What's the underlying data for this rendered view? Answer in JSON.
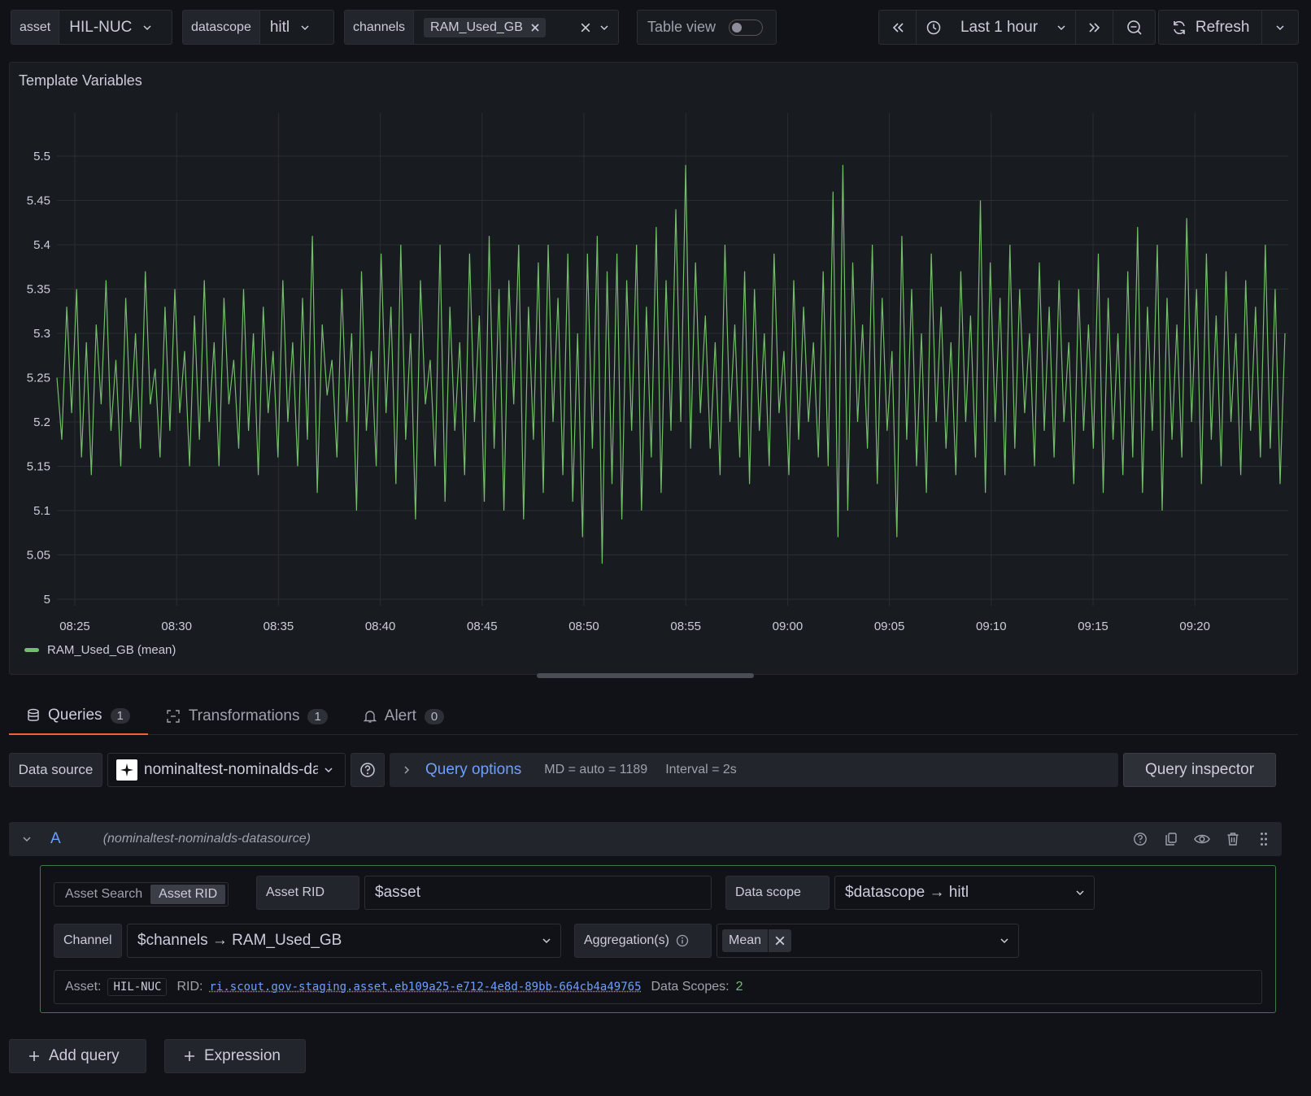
{
  "variables": {
    "asset": {
      "label": "asset",
      "value": "HIL-NUC"
    },
    "datascope": {
      "label": "datascope",
      "value": "hitl"
    },
    "channels": {
      "label": "channels",
      "chip": "RAM_Used_GB"
    },
    "table_view": {
      "label": "Table view",
      "on": false
    }
  },
  "time_controls": {
    "range": "Last 1 hour",
    "refresh": "Refresh"
  },
  "panel": {
    "title": "Template Variables",
    "legend": "RAM_Used_GB (mean)"
  },
  "colors": {
    "series": "#73bf69",
    "accent_blue": "#6e9fff",
    "active_tab": "#f55f3e"
  },
  "chart_data": {
    "type": "line",
    "x_ticks": [
      "08:25",
      "08:30",
      "08:35",
      "08:40",
      "08:45",
      "08:50",
      "08:55",
      "09:00",
      "09:05",
      "09:10",
      "09:15",
      "09:20"
    ],
    "y_ticks": [
      "5",
      "5.05",
      "5.1",
      "5.15",
      "5.2",
      "5.25",
      "5.3",
      "5.35",
      "5.4",
      "5.45",
      "5.5"
    ],
    "ylim": [
      5.0,
      5.5
    ],
    "x_range": [
      "08:24:12",
      "09:24:10"
    ],
    "grid": true,
    "legend_placement": "bottom-left",
    "series": [
      {
        "name": "RAM_Used_GB (mean)",
        "color": "#73bf69",
        "values": [
          5.25,
          5.18,
          5.33,
          5.21,
          5.35,
          5.16,
          5.29,
          5.14,
          5.31,
          5.22,
          5.36,
          5.19,
          5.27,
          5.15,
          5.34,
          5.2,
          5.3,
          5.17,
          5.37,
          5.22,
          5.26,
          5.16,
          5.33,
          5.19,
          5.35,
          5.21,
          5.28,
          5.15,
          5.32,
          5.18,
          5.36,
          5.2,
          5.29,
          5.15,
          5.34,
          5.22,
          5.27,
          5.17,
          5.35,
          5.19,
          5.3,
          5.14,
          5.33,
          5.21,
          5.28,
          5.16,
          5.36,
          5.2,
          5.29,
          5.15,
          5.34,
          5.18,
          5.41,
          5.12,
          5.31,
          5.23,
          5.27,
          5.16,
          5.35,
          5.2,
          5.3,
          5.1,
          5.37,
          5.19,
          5.28,
          5.15,
          5.39,
          5.21,
          5.33,
          5.13,
          5.4,
          5.18,
          5.3,
          5.09,
          5.36,
          5.22,
          5.27,
          5.15,
          5.4,
          5.11,
          5.33,
          5.19,
          5.29,
          5.14,
          5.39,
          5.2,
          5.32,
          5.11,
          5.41,
          5.17,
          5.35,
          5.1,
          5.36,
          5.22,
          5.4,
          5.09,
          5.33,
          5.18,
          5.38,
          5.12,
          5.4,
          5.2,
          5.34,
          5.14,
          5.39,
          5.11,
          5.3,
          5.07,
          5.39,
          5.17,
          5.41,
          5.04,
          5.37,
          5.13,
          5.39,
          5.09,
          5.36,
          5.19,
          5.4,
          5.1,
          5.33,
          5.16,
          5.42,
          5.12,
          5.36,
          5.19,
          5.44,
          5.2,
          5.49,
          5.17,
          5.38,
          5.21,
          5.32,
          5.17,
          5.29,
          5.14,
          5.4,
          5.2,
          5.31,
          5.16,
          5.37,
          5.13,
          5.35,
          5.19,
          5.3,
          5.15,
          5.39,
          5.21,
          5.28,
          5.14,
          5.36,
          5.18,
          5.33,
          5.2,
          5.29,
          5.16,
          5.37,
          5.15,
          5.46,
          5.07,
          5.49,
          5.1,
          5.38,
          5.2,
          5.31,
          5.17,
          5.4,
          5.13,
          5.34,
          5.19,
          5.28,
          5.07,
          5.41,
          5.18,
          5.35,
          5.15,
          5.3,
          5.12,
          5.39,
          5.2,
          5.33,
          5.17,
          5.29,
          5.14,
          5.37,
          5.2,
          5.32,
          5.16,
          5.45,
          5.12,
          5.38,
          5.2,
          5.34,
          5.14,
          5.4,
          5.17,
          5.35,
          5.21,
          5.3,
          5.15,
          5.38,
          5.19,
          5.33,
          5.16,
          5.36,
          5.2,
          5.29,
          5.13,
          5.35,
          5.19,
          5.31,
          5.17,
          5.39,
          5.12,
          5.34,
          5.18,
          5.3,
          5.14,
          5.37,
          5.16,
          5.42,
          5.12,
          5.33,
          5.19,
          5.4,
          5.1,
          5.34,
          5.18,
          5.31,
          5.16,
          5.43,
          5.2,
          5.35,
          5.13,
          5.39,
          5.18,
          5.32,
          5.15,
          5.37,
          5.2,
          5.3,
          5.14,
          5.36,
          5.19,
          5.33,
          5.16,
          5.4,
          5.17,
          5.35,
          5.13,
          5.3
        ]
      }
    ]
  },
  "tabs": [
    {
      "label": "Queries",
      "count": "1",
      "icon": "database-icon"
    },
    {
      "label": "Transformations",
      "count": "1",
      "icon": "transform-icon"
    },
    {
      "label": "Alert",
      "count": "0",
      "icon": "bell-icon"
    }
  ],
  "query_bar": {
    "datasource_label": "Data source",
    "datasource_value": "nominaltest-nominalds-datasource",
    "options_label": "Query options",
    "md": "MD = auto = 1189",
    "interval": "Interval = 2s",
    "inspector": "Query inspector"
  },
  "query": {
    "ref": "A",
    "datasource": "(nominaltest-nominalds-datasource)",
    "mode_options": [
      "Asset Search",
      "Asset RID"
    ],
    "mode_selected": "Asset RID",
    "asset_rid_label": "Asset RID",
    "asset_rid_value": "$asset",
    "datascope_label": "Data scope",
    "datascope_value": "$datascope → hitl",
    "channel_label": "Channel",
    "channel_value": "$channels → RAM_Used_GB",
    "aggregation_label": "Aggregation(s)",
    "aggregation_value": "Mean",
    "info": {
      "asset_label": "Asset:",
      "asset_value": "HIL-NUC",
      "rid_label": "RID:",
      "rid_value": "ri.scout.gov-staging.asset.eb109a25-e712-4e8d-89bb-664cb4a49765",
      "scopes_label": "Data Scopes:",
      "scopes_value": "2"
    }
  },
  "footer": {
    "add_query": "Add query",
    "expression": "Expression"
  }
}
